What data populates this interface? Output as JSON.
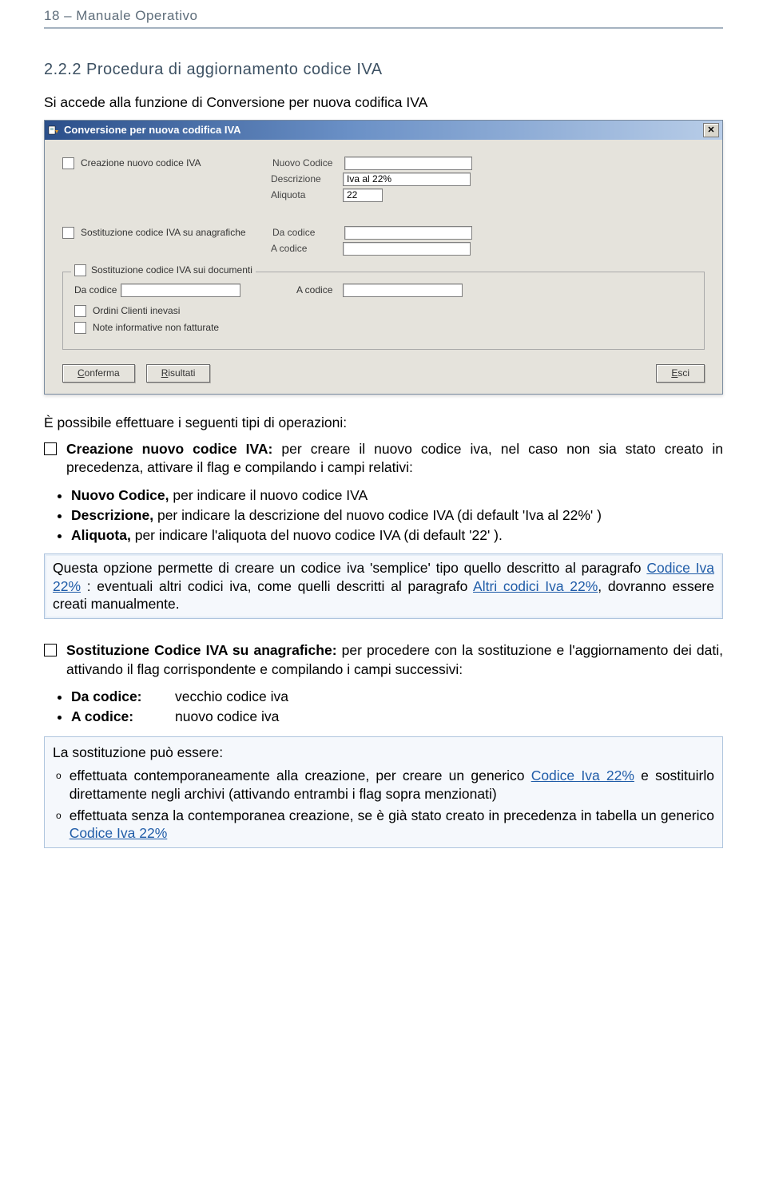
{
  "header": "18 – Manuale Operativo",
  "section_title": "2.2.2 Procedura di aggiornamento codice IVA",
  "intro_line": "Si accede alla funzione di Conversione per nuova codifica IVA",
  "window": {
    "title": "Conversione per nuova codifica IVA",
    "close_glyph": "✕",
    "creazione_label": "Creazione nuovo codice IVA",
    "nuovo_codice_label": "Nuovo Codice",
    "descrizione_label": "Descrizione",
    "descrizione_value": "Iva al 22%",
    "aliquota_label": "Aliquota",
    "aliquota_value": "22",
    "sost_anag_label": "Sostituzione codice IVA su anagrafiche",
    "da_codice_label": "Da codice",
    "a_codice_label": "A codice",
    "sost_doc_label": "Sostituzione codice IVA sui documenti",
    "da_codice2_label": "Da codice",
    "a_codice2_label": "A codice",
    "ordini_label": "Ordini Clienti inevasi",
    "note_label": "Note informative non fatturate",
    "btn_conferma": "Conferma",
    "btn_risultati": "Risultati",
    "btn_esci": "Esci",
    "btn_conferma_ul": "C",
    "btn_risultati_ul": "R",
    "btn_esci_ul": "E"
  },
  "after_window": "È possibile effettuare i seguenti tipi di operazioni:",
  "item1": {
    "lead_bold": "Creazione nuovo codice IVA:",
    "lead_rest": "  per creare il nuovo codice iva, nel caso non sia stato creato in precedenza, attivare il flag e compilando i campi relativi:",
    "b1_bold": "Nuovo Codice,",
    "b1_rest": " per indicare il nuovo codice IVA",
    "b2_bold": "Descrizione,",
    "b2_rest": " per indicare la descrizione del nuovo codice IVA (di default 'Iva al 22%' )",
    "b3_bold": "Aliquota,",
    "b3_rest": " per indicare l'aliquota del nuovo codice IVA (di default '22' )."
  },
  "callout1": {
    "p1a": "Questa opzione permette di creare un codice iva 'semplice' tipo quello descritto al paragrafo ",
    "link1": "Codice Iva 22%",
    "p1b": " : eventuali altri codici iva, come quelli descritti al paragrafo ",
    "link2": "Altri codici Iva 22%",
    "p1c": ", dovranno essere creati manualmente."
  },
  "item2": {
    "lead_bold": "Sostituzione Codice IVA su anagrafiche:",
    "lead_rest": " per procedere con la sostituzione e l'aggiornamento dei dati, attivando il flag corrispondente e compilando i campi successivi:",
    "da_label": "Da codice:",
    "da_val": "vecchio codice iva",
    "a_label": "A codice:",
    "a_val": "nuovo codice iva"
  },
  "callout2": {
    "lead": "La sostituzione può essere:",
    "s1a": "effettuata contemporaneamente alla creazione, per creare un generico ",
    "s1_link": "Codice Iva 22%",
    "s1b": " e sostituirlo direttamente negli archivi (attivando entrambi i flag sopra menzionati)",
    "s2a": "effettuata senza la contemporanea creazione, se è già stato creato in precedenza in tabella un generico ",
    "s2_link": "Codice Iva 22%"
  }
}
